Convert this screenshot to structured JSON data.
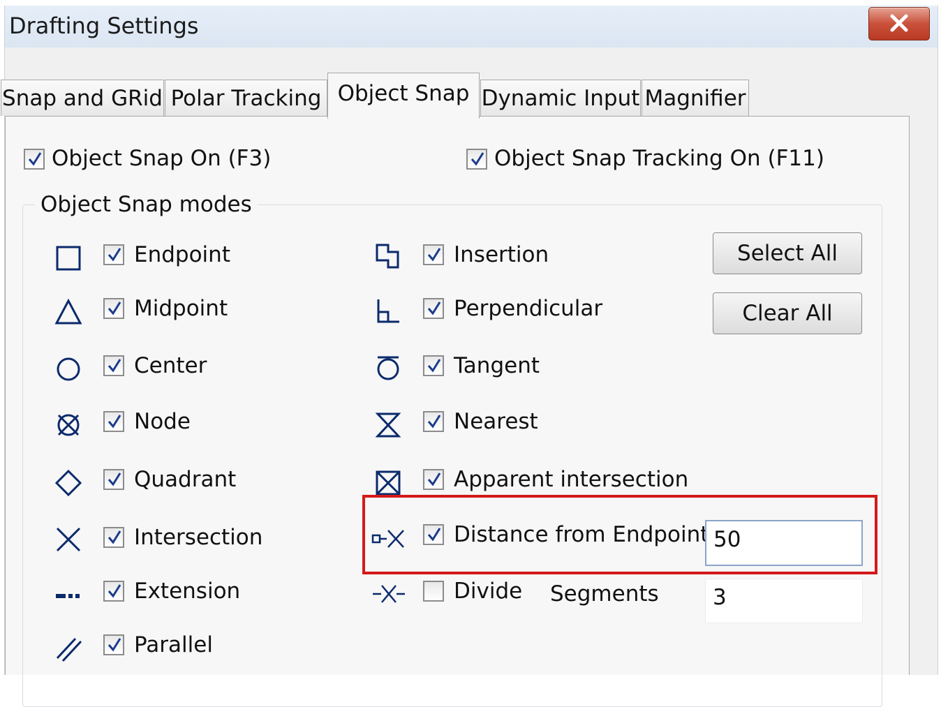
{
  "window": {
    "title": "Drafting Settings"
  },
  "tabs": [
    {
      "label": "Snap and GRid"
    },
    {
      "label": "Polar Tracking"
    },
    {
      "label": "Object Snap"
    },
    {
      "label": "Dynamic Input"
    },
    {
      "label": "Magnifier"
    }
  ],
  "active_tab": "Object Snap",
  "object_snap_on": {
    "label": "Object Snap On (F3)",
    "checked": true
  },
  "object_snap_tracking_on": {
    "label": "Object Snap Tracking On (F11)",
    "checked": true
  },
  "modes_group": {
    "title": "Object Snap modes"
  },
  "left_modes": [
    {
      "label": "Endpoint",
      "icon": "endpoint-icon",
      "checked": true
    },
    {
      "label": "Midpoint",
      "icon": "midpoint-icon",
      "checked": true
    },
    {
      "label": "Center",
      "icon": "center-icon",
      "checked": true
    },
    {
      "label": "Node",
      "icon": "node-icon",
      "checked": true
    },
    {
      "label": "Quadrant",
      "icon": "quadrant-icon",
      "checked": true
    },
    {
      "label": "Intersection",
      "icon": "intersection-icon",
      "checked": true
    },
    {
      "label": "Extension",
      "icon": "extension-icon",
      "checked": true
    },
    {
      "label": "Parallel",
      "icon": "parallel-icon",
      "checked": true
    }
  ],
  "right_modes": [
    {
      "label": "Insertion",
      "icon": "insertion-icon",
      "checked": true
    },
    {
      "label": "Perpendicular",
      "icon": "perpendicular-icon",
      "checked": true
    },
    {
      "label": "Tangent",
      "icon": "tangent-icon",
      "checked": true
    },
    {
      "label": "Nearest",
      "icon": "nearest-icon",
      "checked": true
    },
    {
      "label": "Apparent intersection",
      "icon": "apparent-intersection-icon",
      "checked": true
    },
    {
      "label": "Distance from Endpoint",
      "icon": "distance-from-endpoint-icon",
      "checked": true
    },
    {
      "label": "Divide",
      "icon": "divide-icon",
      "checked": false
    }
  ],
  "buttons": {
    "select_all": "Select All",
    "clear_all": "Clear All"
  },
  "distance_value": "50",
  "segments": {
    "label": "Segments",
    "value": "3"
  },
  "colors": {
    "highlight": "#d41a1a",
    "checkmark": "#1a3b8c",
    "icon_stroke": "#0b2a6b"
  }
}
